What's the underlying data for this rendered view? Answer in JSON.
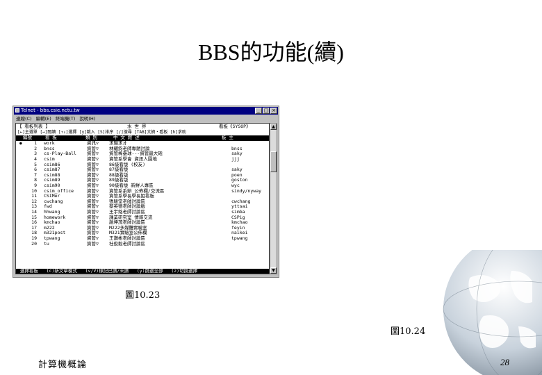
{
  "slide": {
    "title": "BBS的功能(續)",
    "caption_1": "圖10.23",
    "caption_2": "圖10.24",
    "footer_left": "計算機概論",
    "page_number": "28"
  },
  "window": {
    "title": "Telnet - bbs.csie.nctu.tw",
    "menu": [
      "連線(C)",
      "編輯(E)",
      "終端機(T)",
      "說明(H)"
    ],
    "minimize": "_",
    "maximize": "□",
    "close": "×"
  },
  "terminal": {
    "header_left": "【 看板列表 】",
    "header_center": "水 世 界",
    "header_right": "看板《SYSOP》",
    "help_line": "[←]主選單 [→]閱讀 [↑↓]選擇 [y]載入 [S]排序 [/]搜尋 [TAB]文摘・看板 [h]求助",
    "columns": {
      "no": "編號",
      "board": "看 板",
      "category": "類 別",
      "title": "中 文 敘 述",
      "moderator": "板 主"
    },
    "rows": [
      {
        "no": "1",
        "board": "work",
        "category": "資訊▽",
        "title": "求職求才",
        "mod": ""
      },
      {
        "no": "2",
        "board": "bnss",
        "category": "資管▽",
        "title": "林耀鈞老師專題討論",
        "mod": "bnss"
      },
      {
        "no": "3",
        "board": "cs-Play-Ball",
        "category": "資管▽",
        "title": "資管棒壘球---資管最大砲",
        "mod": "saky"
      },
      {
        "no": "4",
        "board": "csim",
        "category": "資管▽",
        "title": "資管系學會 資訊人園地",
        "mod": "jjj"
      },
      {
        "no": "5",
        "board": "csim86",
        "category": "資管▽",
        "title": "86級看版 (校友)",
        "mod": ""
      },
      {
        "no": "6",
        "board": "csim87",
        "category": "資管▽",
        "title": "87級看版",
        "mod": "saky"
      },
      {
        "no": "7",
        "board": "csim88",
        "category": "資管▽",
        "title": "88級看版",
        "mod": "poen"
      },
      {
        "no": "8",
        "board": "csim89",
        "category": "資管▽",
        "title": "89級看版",
        "mod": "goston"
      },
      {
        "no": "9",
        "board": "csim90",
        "category": "資管▽",
        "title": "90級看版 新鮮人專區",
        "mod": "wyc"
      },
      {
        "no": "10",
        "board": "csim_office",
        "category": "資管▽",
        "title": "資管系系辦 公佈欄/交流區",
        "mod": "sindy/nyway"
      },
      {
        "no": "11",
        "board": "CSIMer",
        "category": "資管▽",
        "title": "資管系學長學長姐看板",
        "mod": ""
      },
      {
        "no": "12",
        "board": "cwchang",
        "category": "資管▽",
        "title": "張駿堂老師討論區",
        "mod": "cwchang"
      },
      {
        "no": "13",
        "board": "fwd",
        "category": "資管▽",
        "title": "蔡英德老師討論版",
        "mod": "yttsai"
      },
      {
        "no": "14",
        "board": "hhwang",
        "category": "資管▽",
        "title": "王宇銘老師討論區",
        "mod": "simba"
      },
      {
        "no": "15",
        "board": "homework",
        "category": "資管▽",
        "title": "課業研究室 情報交流",
        "mod": "CSPig"
      },
      {
        "no": "16",
        "board": "kmchao",
        "category": "資管▽",
        "title": "趙坤茂老師討論區",
        "mod": "kmchao"
      },
      {
        "no": "17",
        "board": "m222",
        "category": "資管▽",
        "title": "M222多媒體實驗室",
        "mod": "feyin"
      },
      {
        "no": "18",
        "board": "m321post",
        "category": "資管▽",
        "title": "M321實驗室公佈欄",
        "mod": "naikei"
      },
      {
        "no": "19",
        "board": "tpwang",
        "category": "資管▽",
        "title": "王讚彬老師討論區",
        "mod": "tpwang"
      },
      {
        "no": "20",
        "board": "tu",
        "category": "資管▽",
        "title": "杜俊毅老師討論區",
        "mod": ""
      }
    ],
    "footer": " 選擇看板   (c)新文章模式   (v/V)標記已讀/未讀   (y)篩選全部   (z)切換選擇"
  }
}
